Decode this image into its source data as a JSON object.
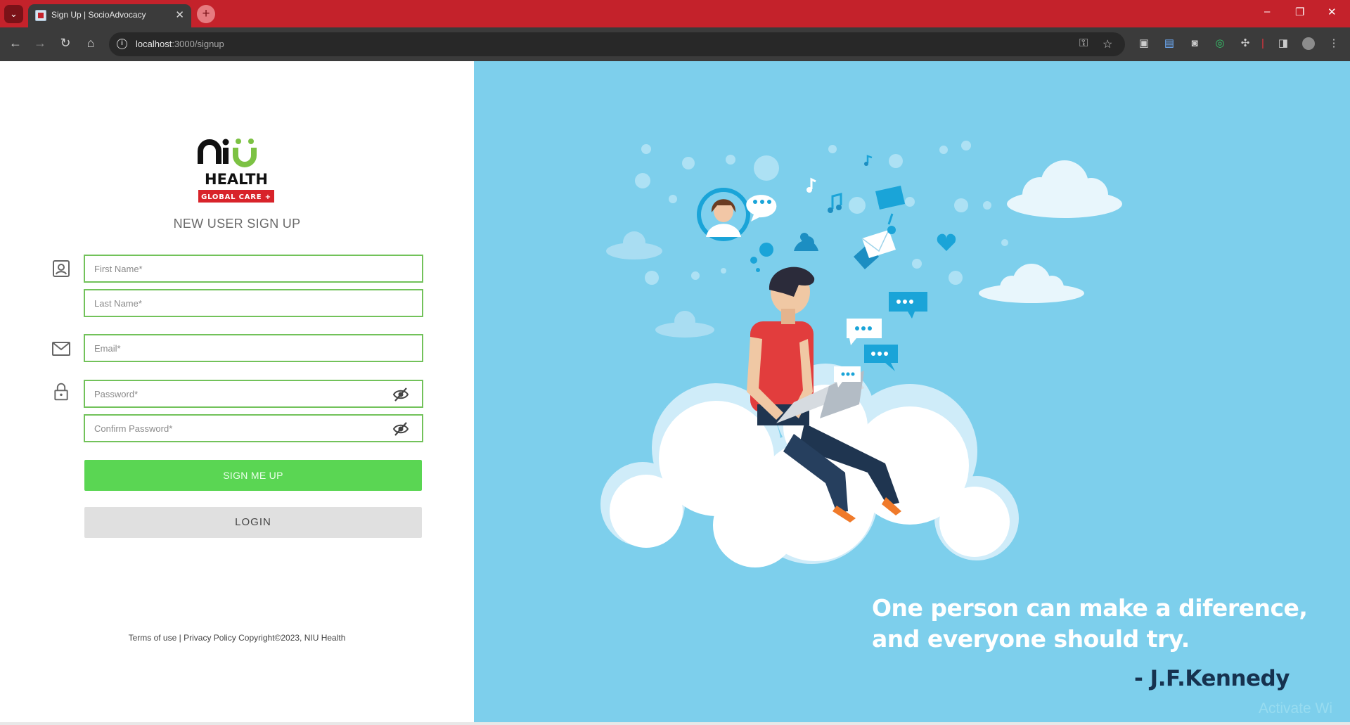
{
  "browser": {
    "tab_title": "Sign Up | SocioAdvocacy",
    "tab_close": "✕",
    "new_tab": "+",
    "url_host": "localhost",
    "url_rest": ":3000/signup",
    "window_controls": {
      "minimize": "–",
      "restore": "❐",
      "close": "✕"
    }
  },
  "logo": {
    "brand": "niu",
    "name": "HEALTH",
    "tagline": "GLOBAL CARE +"
  },
  "form": {
    "heading": "NEW USER SIGN UP",
    "first_name_placeholder": "First Name*",
    "last_name_placeholder": "Last Name*",
    "email_placeholder": "Email*",
    "password_placeholder": "Password*",
    "confirm_password_placeholder": "Confirm Password*",
    "sign_up_label": "SIGN ME UP",
    "login_label": "LOGIN"
  },
  "footer": {
    "terms": "Terms of use",
    "separator": "|",
    "privacy": "Privacy Policy",
    "copyright": "Copyright",
    "copyright_symbol": "©",
    "year_owner": "2023, NIU Health"
  },
  "hero": {
    "quote_line1": "One person can make a diference,",
    "quote_line2": "and everyone should try.",
    "author": "- J.F.Kennedy",
    "watermark": "Activate Wi"
  },
  "colors": {
    "chrome_red": "#c4222b",
    "accent_green": "#5ad653",
    "field_border": "#72c25a",
    "hero_blue": "#7dcfec",
    "author_navy": "#16324f"
  }
}
